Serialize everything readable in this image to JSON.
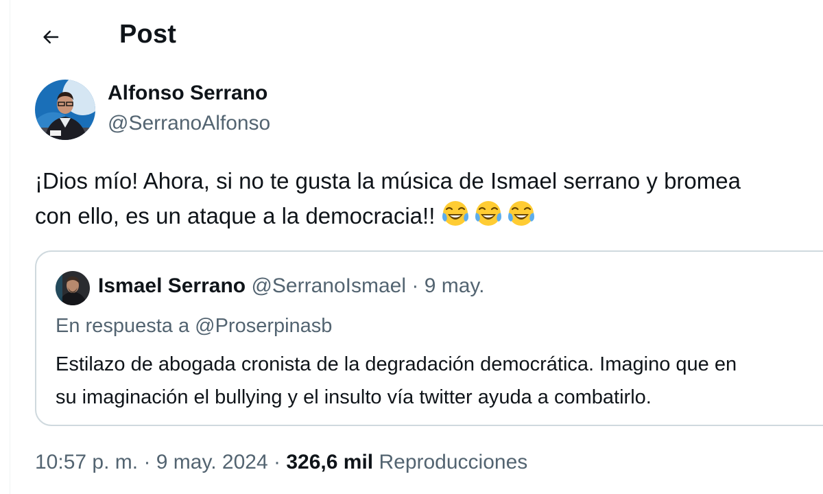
{
  "header": {
    "title": "Post"
  },
  "author": {
    "name": "Alfonso Serrano",
    "handle": "@SerranoAlfonso"
  },
  "tweet": {
    "line1": "¡Dios mío! Ahora, si no te gusta la música de Ismael serrano y bromea",
    "line2": "con ello,  es un ataque a la democracia!!",
    "emoji_icon": "face-with-tears-of-joy-icon",
    "emoji_count": 3
  },
  "quote": {
    "name": "Ismael Serrano",
    "handle": "@SerranoIsmael",
    "separator": "·",
    "date": "9 may.",
    "reply_to": "En respuesta a @Proserpinasb",
    "line1": "Estilazo de abogada cronista de la degradación democrática. Imagino que en",
    "line2": "su imaginación el bullying y el insulto vía twitter ayuda a combatirlo."
  },
  "meta": {
    "time": "10:57 p. m.",
    "dot": "·",
    "date": "9 may. 2024",
    "views_count": "326,6 mil",
    "views_label": "Reproducciones"
  },
  "colors": {
    "text": "#0f1419",
    "secondary": "#536471",
    "border": "#cfd9de"
  }
}
